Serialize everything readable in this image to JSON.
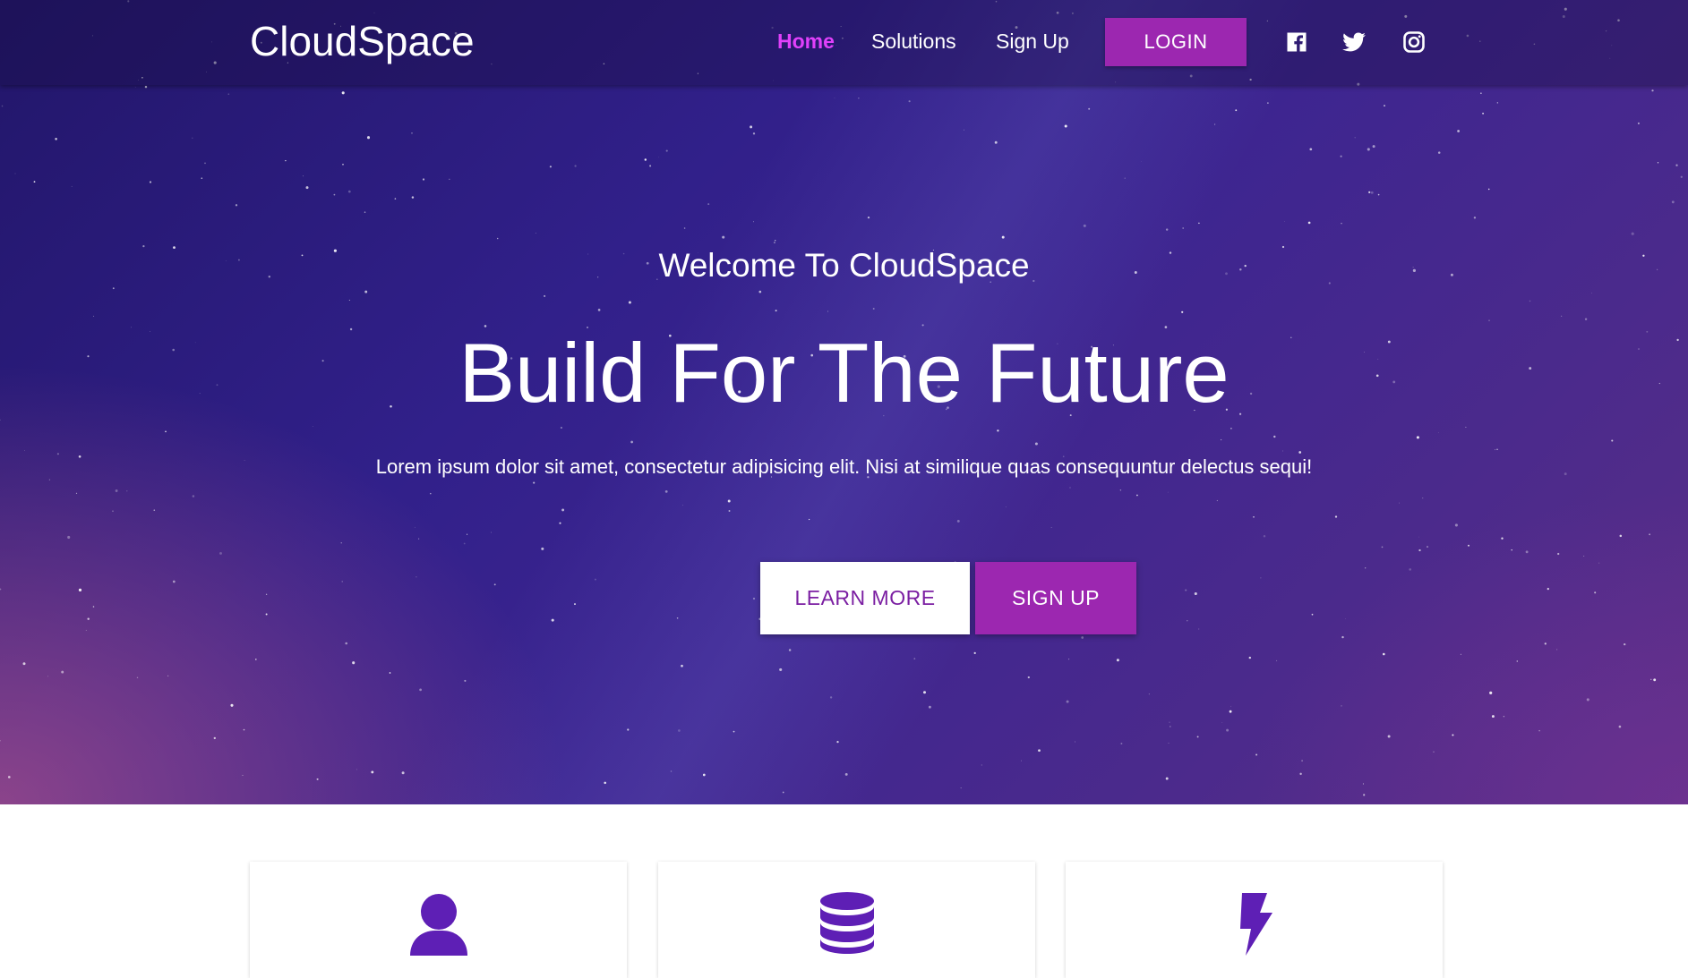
{
  "navbar": {
    "brand": "CloudSpace",
    "links": [
      {
        "label": "Home",
        "active": true
      },
      {
        "label": "Solutions",
        "active": false
      },
      {
        "label": "Sign Up",
        "active": false
      }
    ],
    "login_label": "LOGIN",
    "social": [
      "facebook-icon",
      "twitter-icon",
      "instagram-icon"
    ]
  },
  "hero": {
    "welcome": "Welcome To CloudSpace",
    "headline": "Build For The Future",
    "lead": "Lorem ipsum dolor sit amet, consectetur adipisicing elit. Nisi at similique quas consequuntur delectus sequi!",
    "learn_more_label": "LEARN MORE",
    "sign_up_label": "SIGN UP"
  },
  "features": {
    "cards": [
      {
        "icon": "user-icon"
      },
      {
        "icon": "database-icon"
      },
      {
        "icon": "bolt-icon"
      }
    ]
  },
  "colors": {
    "accent": "#9c27b0",
    "active_link": "#e040fb",
    "icon": "#5e1fb5"
  }
}
